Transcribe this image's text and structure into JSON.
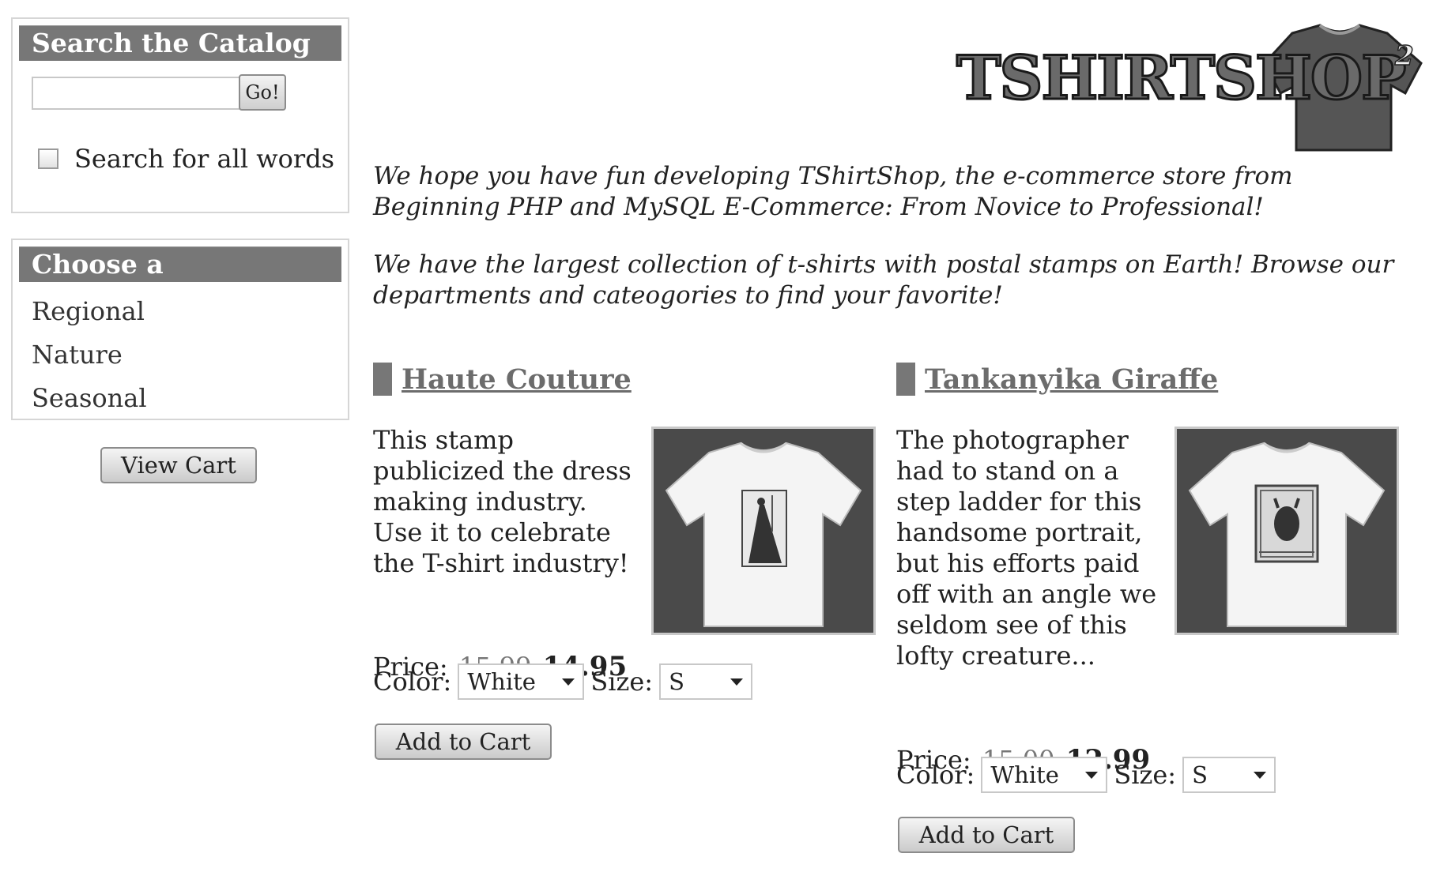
{
  "search": {
    "title": "Search the Catalog",
    "input_value": "",
    "go_label": "Go!",
    "all_words_label": "Search for all words",
    "all_words_checked": false
  },
  "departments": {
    "title": "Choose a Department",
    "items": [
      "Regional",
      "Nature",
      "Seasonal"
    ]
  },
  "cart": {
    "view_label": "View Cart"
  },
  "logo": {
    "text": "TSHIRTSHOP",
    "superscript": "2"
  },
  "intro": {
    "p1": "We hope you have fun developing TShirtShop, the e-commerce store from Beginning PHP and MySQL E-Commerce: From Novice to Professional!",
    "p2": "We have the largest collection of t-shirts with postal stamps on Earth! Browse our departments and cateogories to find your favorite!"
  },
  "products": [
    {
      "name": "Haute Couture",
      "description": "This stamp publicized the dress making industry. Use it to celebrate the T-shirt industry!",
      "price_label": "Price:",
      "old_price": "15.99",
      "price": "14.95",
      "color_label": "Color:",
      "color_value": "White",
      "size_label": "Size:",
      "size_value": "S",
      "add_label": "Add to Cart",
      "image_icon": "tshirt-stamp-dress-icon"
    },
    {
      "name": "Tankanyika Giraffe",
      "description": "The photographer had to stand on a step ladder for this handsome portrait, but his efforts paid off with an angle we seldom see of this lofty creature...",
      "price_label": "Price:",
      "old_price": "15.00",
      "price": "12.99",
      "color_label": "Color:",
      "color_value": "White",
      "size_label": "Size:",
      "size_value": "S",
      "add_label": "Add to Cart",
      "image_icon": "tshirt-stamp-giraffe-icon"
    }
  ],
  "colors": {
    "header_bg": "#777777",
    "title_link": "#6c6c6c",
    "image_bg": "#4a4a4a"
  }
}
